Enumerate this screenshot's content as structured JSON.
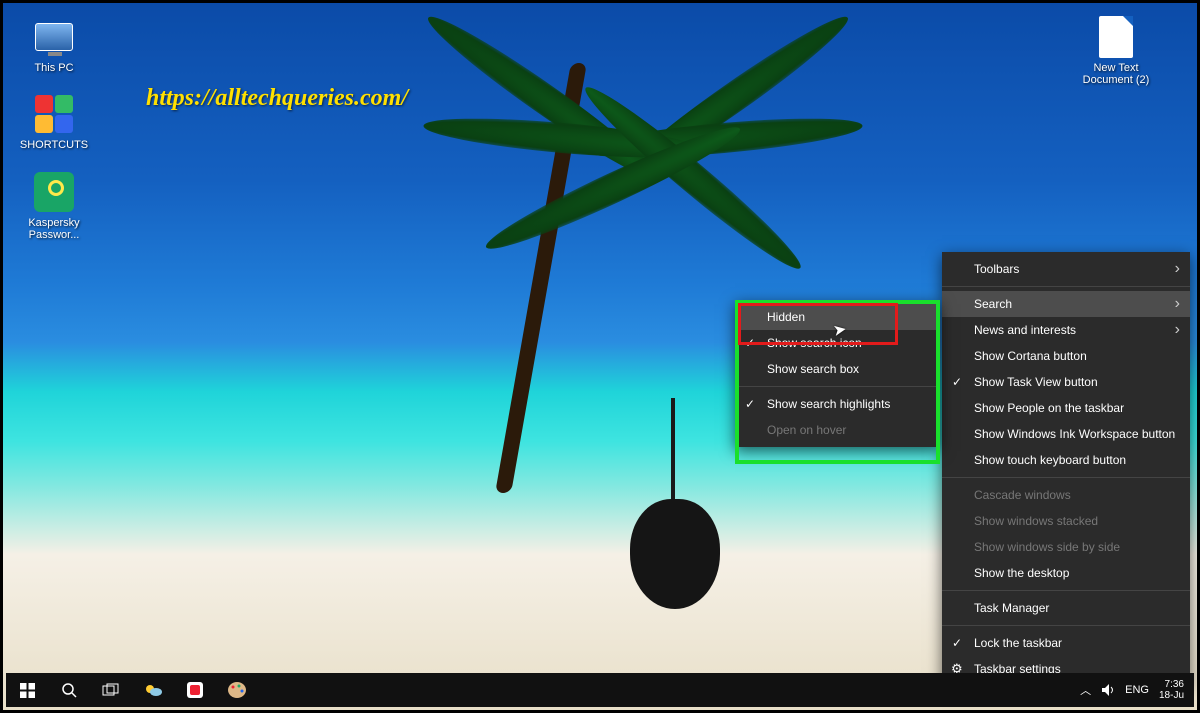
{
  "watermark_url": "https://alltechqueries.com/",
  "desktop_icons": {
    "this_pc": "This PC",
    "shortcuts": "SHORTCUTS",
    "kaspersky": "Kaspersky Passwor...",
    "new_text": "New Text Document (2)"
  },
  "main_menu": {
    "toolbars": "Toolbars",
    "search": "Search",
    "news": "News and interests",
    "cortana": "Show Cortana button",
    "taskview": "Show Task View button",
    "people": "Show People on the taskbar",
    "ink": "Show Windows Ink Workspace button",
    "touchkb": "Show touch keyboard button",
    "cascade": "Cascade windows",
    "stacked": "Show windows stacked",
    "sidebyside": "Show windows side by side",
    "showdesk": "Show the desktop",
    "taskmgr": "Task Manager",
    "lock": "Lock the taskbar",
    "settings": "Taskbar settings"
  },
  "search_submenu": {
    "hidden": "Hidden",
    "showicon": "Show search icon",
    "showbox": "Show search box",
    "highlights": "Show search highlights",
    "openhover": "Open on hover"
  },
  "tray": {
    "lang": "ENG",
    "time": "7:36",
    "date": "18-Ju"
  }
}
